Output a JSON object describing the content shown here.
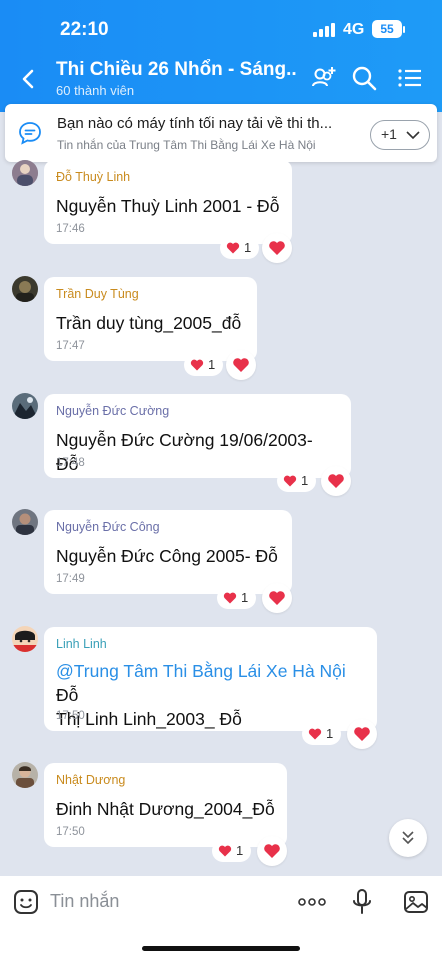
{
  "status_bar": {
    "time": "22:10",
    "network": "4G",
    "battery": "55"
  },
  "header": {
    "title": "Thi Chiều 26 Nhổn - Sáng...",
    "members": "60 thành viên",
    "icons": [
      "back-arrow-icon",
      "add-member-icon",
      "search-icon",
      "menu-icon"
    ]
  },
  "pinned": {
    "text": "Bạn nào có máy tính tối nay tải về thi th...",
    "sub": "Tin nhắn của Trung Tâm Thi Bằng Lái Xe Hà Nội",
    "more": "+1"
  },
  "messages": [
    {
      "sender": "Đỗ Thuỳ Linh",
      "sender_color": "#c98b1e",
      "text": "Nguyễn Thuỳ Linh 2001 - Đỗ",
      "time": "17:46",
      "reactions": "1"
    },
    {
      "sender": "Trần Duy Tùng",
      "sender_color": "#c98b1e",
      "text": "Trần duy tùng_2005_đỗ",
      "time": "17:47",
      "reactions": "1"
    },
    {
      "sender": "Nguyễn Đức Cường",
      "sender_color": "#6a6fa8",
      "text": "Nguyễn Đức Cường 19/06/2003- Đỗ",
      "time": "17:48",
      "reactions": "1"
    },
    {
      "sender": "Nguyễn Đức Công",
      "sender_color": "#6a6fa8",
      "text": "Nguyễn Đức Công 2005- Đỗ",
      "time": "17:49",
      "reactions": "1"
    },
    {
      "sender": "Linh Linh",
      "sender_color": "#3aa0b8",
      "mention": "@Trung Tâm Thi Bằng Lái Xe Hà Nội",
      "text_after": " Đỗ",
      "text_line2": "Thị Linh Linh_2003_ Đỗ",
      "time": "17:50",
      "reactions": "1"
    },
    {
      "sender": "Nhật Dương",
      "sender_color": "#c98b1e",
      "text": "Đinh Nhật Dương_2004_Đỗ",
      "time": "17:50",
      "reactions": "1"
    }
  ],
  "input": {
    "placeholder": "Tin nhắn",
    "icons": [
      "sticker-icon",
      "more-icon",
      "microphone-icon",
      "image-icon"
    ]
  },
  "colors": {
    "header": "#1a8cf5",
    "heart": "#e8314a",
    "background": "#dfe4ee"
  }
}
